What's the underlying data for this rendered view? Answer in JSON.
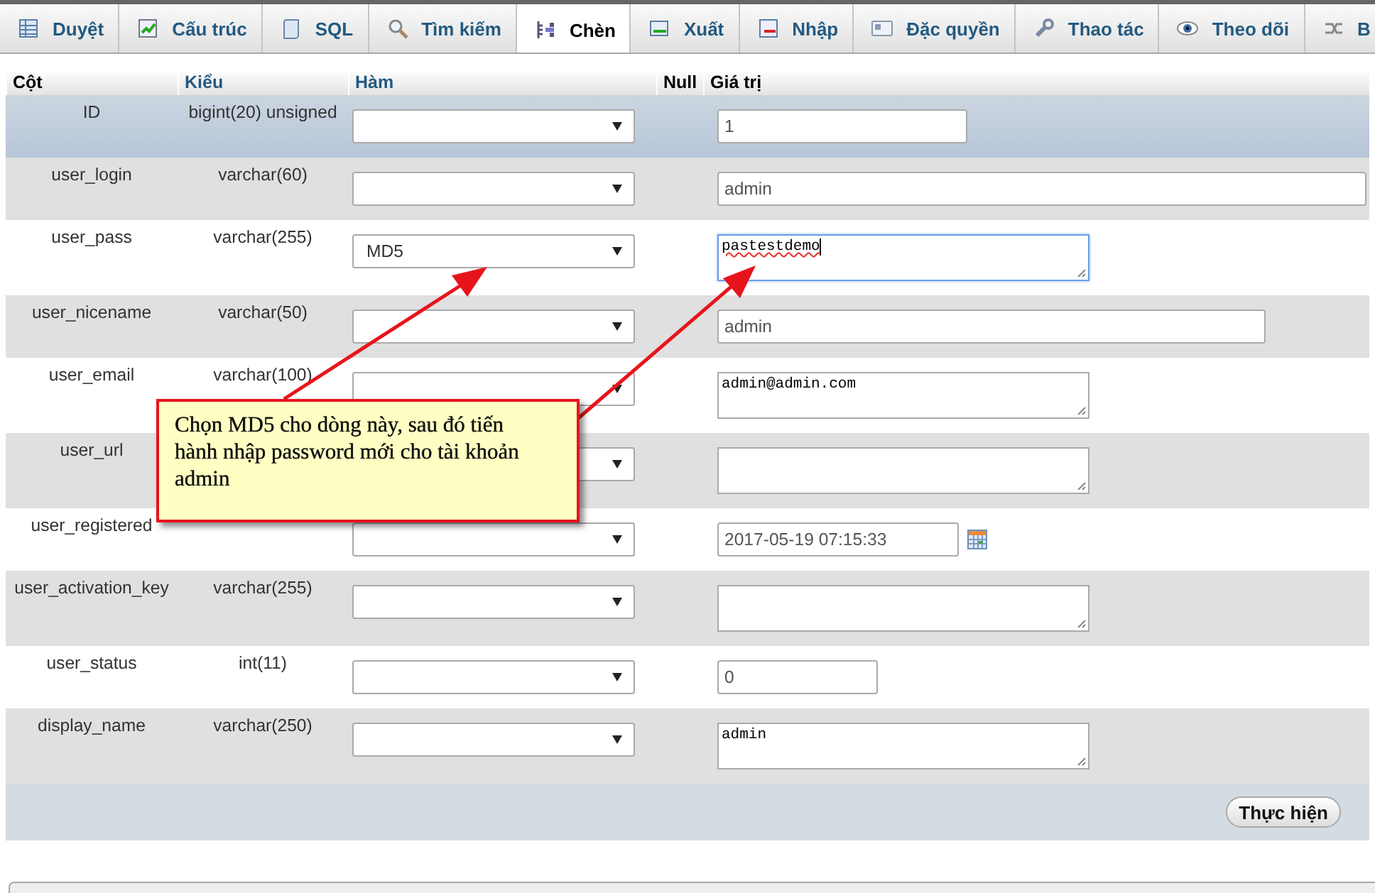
{
  "tabs": [
    {
      "label": "Duyệt",
      "selected": false
    },
    {
      "label": "Cấu trúc",
      "selected": false
    },
    {
      "label": "SQL",
      "selected": false
    },
    {
      "label": "Tìm kiếm",
      "selected": false
    },
    {
      "label": "Chèn",
      "selected": true
    },
    {
      "label": "Xuất",
      "selected": false
    },
    {
      "label": "Nhập",
      "selected": false
    },
    {
      "label": "Đặc quyền",
      "selected": false
    },
    {
      "label": "Thao tác",
      "selected": false
    },
    {
      "label": "Theo dõi",
      "selected": false
    },
    {
      "label": "B",
      "selected": false
    }
  ],
  "table": {
    "columns": [
      {
        "label": "Cột",
        "link": false
      },
      {
        "label": "Kiểu",
        "link": true
      },
      {
        "label": "Hàm",
        "link": true
      },
      {
        "label": "Null",
        "link": false
      },
      {
        "label": "Giá trị",
        "link": false
      }
    ],
    "rows": [
      {
        "column": "ID",
        "type": "bigint(20) unsigned",
        "highlighted": true,
        "value": {
          "kind": "input",
          "text": "1",
          "focused": false
        }
      },
      {
        "column": "user_login",
        "type": "varchar(60)",
        "highlighted": false,
        "value": {
          "kind": "input",
          "text": "admin",
          "focused": false
        }
      },
      {
        "column": "user_pass",
        "type": "varchar(255)",
        "function": "MD5",
        "highlighted": false,
        "value": {
          "kind": "textarea",
          "text": "pastestdemo",
          "focused": true
        }
      },
      {
        "column": "user_nicename",
        "type": "varchar(50)",
        "highlighted": false,
        "value": {
          "kind": "input",
          "text": "admin",
          "focused": false
        }
      },
      {
        "column": "user_email",
        "type": "varchar(100)",
        "highlighted": false,
        "value": {
          "kind": "textarea",
          "text": "admin@admin.com",
          "focused": false
        }
      },
      {
        "column": "user_url",
        "highlighted": false,
        "value": {
          "kind": "textarea",
          "focused": false
        }
      },
      {
        "column": "user_registered",
        "highlighted": false,
        "value": {
          "kind": "datetime",
          "text": "2017-05-19 07:15:33",
          "focused": false
        }
      },
      {
        "column": "user_activation_key",
        "type": "varchar(255)",
        "highlighted": false,
        "value": {
          "kind": "textarea",
          "focused": false
        }
      },
      {
        "column": "user_status",
        "type": "int(11)",
        "highlighted": false,
        "value": {
          "kind": "input",
          "text": "0",
          "focused": false
        }
      },
      {
        "column": "display_name",
        "type": "varchar(250)",
        "highlighted": false,
        "value": {
          "kind": "textarea",
          "text": "admin",
          "focused": false
        }
      }
    ],
    "submit": "Thực hiện"
  },
  "callout": {
    "text": "Chọn MD5 cho dòng này, sau đó tiến hành nhập password mới cho tài khoản admin"
  }
}
